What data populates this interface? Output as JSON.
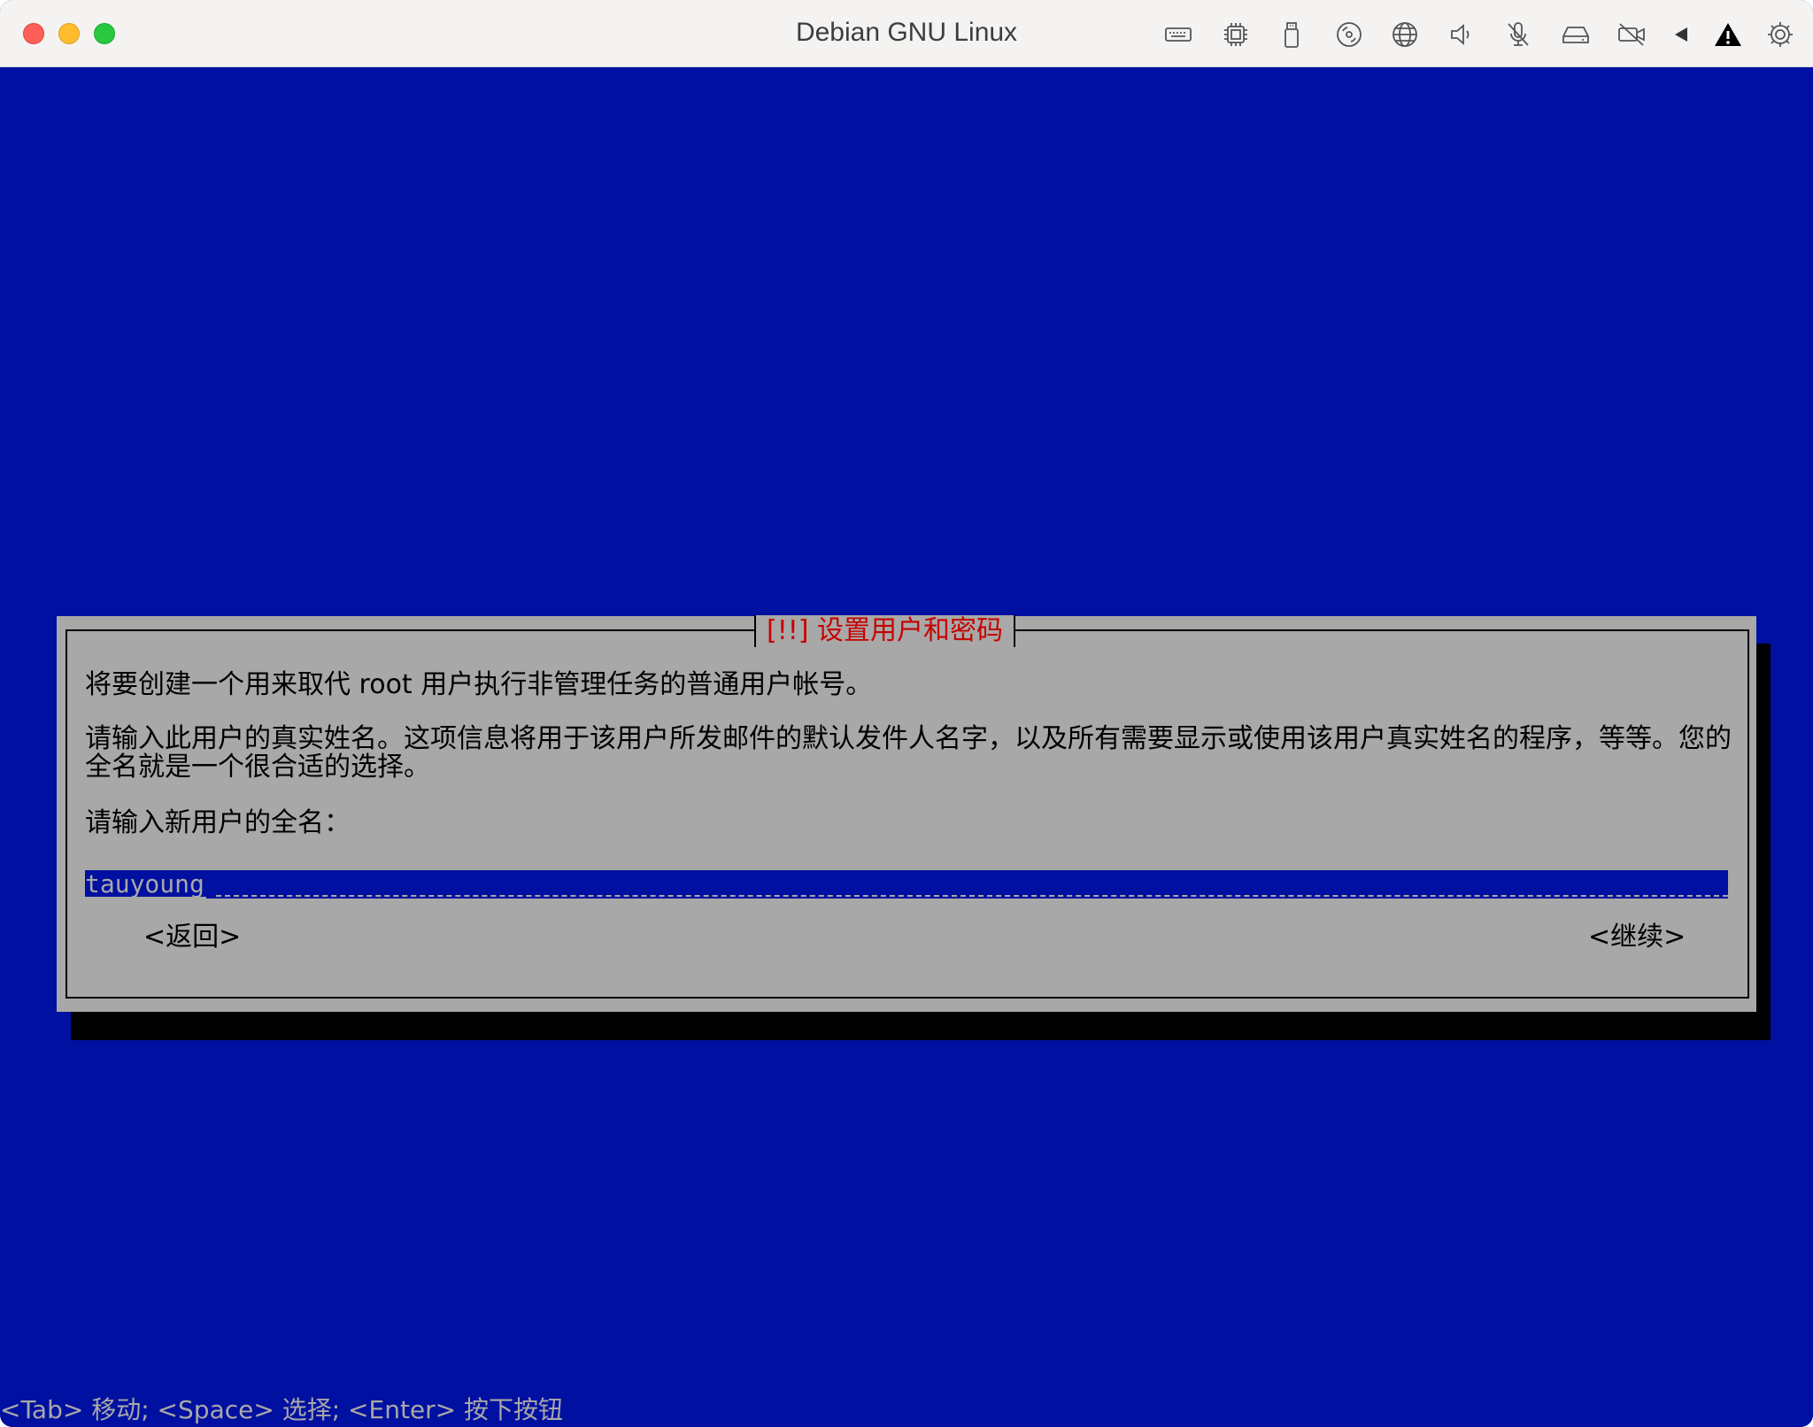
{
  "window": {
    "title": "Debian GNU Linux"
  },
  "toolbar": {
    "icons": [
      "keyboard-icon",
      "cpu-icon",
      "usb-drive-icon",
      "disc-icon",
      "network-globe-icon",
      "speaker-icon",
      "microphone-muted-icon",
      "hard-drive-icon",
      "camera-off-icon",
      "back-arrow-icon",
      "warning-icon",
      "gear-icon"
    ]
  },
  "dialog": {
    "title": "[!!] 设置用户和密码",
    "paragraph1": "将要创建一个用来取代 root 用户执行非管理任务的普通用户帐号。",
    "paragraph2": "请输入此用户的真实姓名。这项信息将用于该用户所发邮件的默认发件人名字，以及所有需要显示或使用该用户真实姓名的程序，等等。您的全名就是一个很合适的选择。",
    "prompt": "请输入新用户的全名：",
    "input_value": "tauyoung",
    "back_label": "<返回>",
    "continue_label": "<继续>"
  },
  "statusbar": {
    "text": "<Tab> 移动; <Space> 选择; <Enter> 按下按钮"
  },
  "colors": {
    "console_bg": "#0010a0",
    "dialog_bg": "#a8a8a8",
    "title_red": "#c80000"
  }
}
